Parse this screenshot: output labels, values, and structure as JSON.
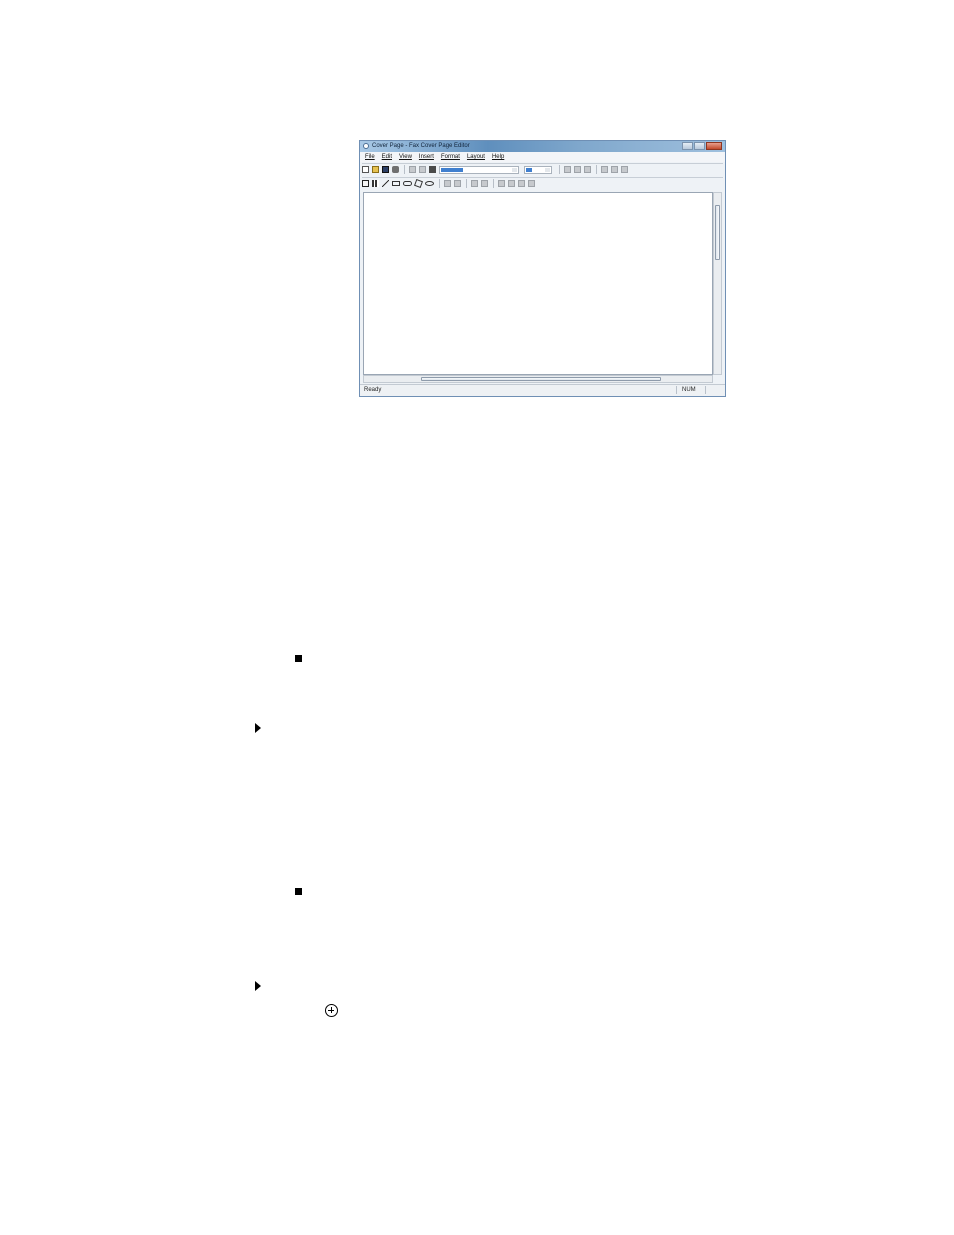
{
  "window": {
    "title": "Cover Page - Fax Cover Page Editor"
  },
  "menu": [
    "File",
    "Edit",
    "View",
    "Insert",
    "Format",
    "Layout",
    "Help"
  ],
  "icons": {
    "toolbar1": [
      "new-doc-icon",
      "open-folder-icon",
      "save-icon",
      "print-icon",
      "cut-icon",
      "copy-icon",
      "paste-icon",
      "font-combo",
      "size-combo",
      "bold-icon",
      "italic-icon",
      "underline-icon",
      "align-left-icon",
      "align-center-icon",
      "align-right-icon"
    ],
    "toolbar2": [
      "select-icon",
      "chart-icon",
      "line-icon",
      "rectangle-icon",
      "rounded-rectangle-icon",
      "polygon-icon",
      "ellipse-icon",
      "bring-to-front-icon",
      "send-to-back-icon",
      "space-across-icon",
      "space-down-icon",
      "align-left-icon",
      "align-right-icon",
      "align-top-icon",
      "align-bottom-icon"
    ],
    "page": [
      "bullet-square",
      "arrow-right",
      "bullet-square",
      "arrow-right",
      "windows-start-icon"
    ]
  },
  "status": {
    "left": "Ready",
    "right": "NUM"
  }
}
